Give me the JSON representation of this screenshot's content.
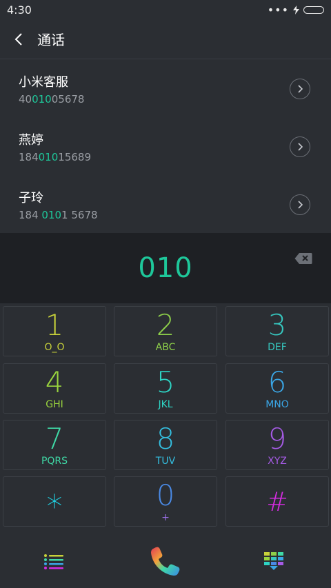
{
  "status_bar": {
    "time": "4:30",
    "dots": "•••"
  },
  "header": {
    "title": "通话"
  },
  "contacts": [
    {
      "name": "小米客服",
      "num_pre": "40",
      "num_hl": "010",
      "num_post": "05678"
    },
    {
      "name": "燕婷",
      "num_pre": "184",
      "num_hl": "010",
      "num_post": "15689"
    },
    {
      "name": "子玲",
      "num_pre": "184 ",
      "num_hl": "010",
      "num_post": "1 5678"
    }
  ],
  "dial_input": {
    "value": "010"
  },
  "keypad": [
    {
      "digit": "1",
      "letters": "O_O",
      "color": "#c8d23a"
    },
    {
      "digit": "2",
      "letters": "ABC",
      "color": "#8ed04a"
    },
    {
      "digit": "3",
      "letters": "DEF",
      "color": "#36c8c0"
    },
    {
      "digit": "4",
      "letters": "GHI",
      "color": "#9ad53e"
    },
    {
      "digit": "5",
      "letters": "JKL",
      "color": "#2ed4c4"
    },
    {
      "digit": "6",
      "letters": "MNO",
      "color": "#3aa6e6"
    },
    {
      "digit": "7",
      "letters": "PQRS",
      "color": "#3fd9a6"
    },
    {
      "digit": "8",
      "letters": "TUV",
      "color": "#34bfe0"
    },
    {
      "digit": "9",
      "letters": "XYZ",
      "color": "#a65be6"
    },
    {
      "digit": "*",
      "letters": "",
      "color": "#1fd6e8"
    },
    {
      "digit": "0",
      "letters": "+",
      "color": "#4a8ae6"
    },
    {
      "digit": "#",
      "letters": "",
      "color": "#d42ce0"
    }
  ],
  "bottom_bar": {
    "left_icon": "list-icon",
    "center_icon": "phone-call-icon",
    "right_icon": "keypad-collapse-icon"
  },
  "colors": {
    "accent": "#1ec79a",
    "background": "#2b2e33",
    "input_background": "#1e2024"
  }
}
